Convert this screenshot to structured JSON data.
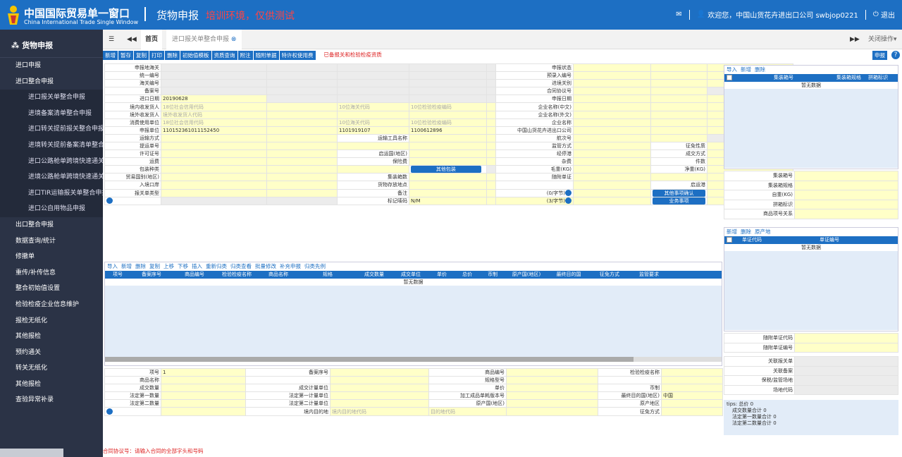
{
  "header": {
    "brand": "中国国际贸易单一窗口",
    "brand_en": "China International Trade Single Window",
    "title": "货物申报",
    "warning": "培训环境，仅供测试",
    "welcome": "欢迎您，中国山货花卉进出口公司 swbjop0221",
    "logout": "退出"
  },
  "sidebar": {
    "title": "货物申报",
    "items": [
      {
        "label": "进口申报",
        "sub": false
      },
      {
        "label": "进口整合申报",
        "sub": false
      },
      {
        "label": "进口报关单整合申报",
        "sub": true
      },
      {
        "label": "进境备案清单整合申报",
        "sub": true
      },
      {
        "label": "进口转关提前报关整合申报",
        "sub": true
      },
      {
        "label": "进境转关提前备案清单整合申报",
        "sub": true
      },
      {
        "label": "进口公路舱单跨境快速通关",
        "sub": true
      },
      {
        "label": "进境公路舱单跨境快速通关",
        "sub": true
      },
      {
        "label": "进口TIR运输报关单整合申报",
        "sub": true
      },
      {
        "label": "进口公自用物品申报",
        "sub": true
      },
      {
        "label": "出口整合申报",
        "sub": false
      },
      {
        "label": "数据查询/统计",
        "sub": false
      },
      {
        "label": "修撤单",
        "sub": false
      },
      {
        "label": "重传/补传信息",
        "sub": false
      },
      {
        "label": "整合初始值设置",
        "sub": false
      },
      {
        "label": "检验检疫企业信息维护",
        "sub": false
      },
      {
        "label": "报检无纸化",
        "sub": false
      },
      {
        "label": "其他报检",
        "sub": false
      },
      {
        "label": "预约通关",
        "sub": false
      },
      {
        "label": "转关无纸化",
        "sub": false
      },
      {
        "label": "其他报检",
        "sub": false
      },
      {
        "label": "查验异常补录",
        "sub": false
      }
    ]
  },
  "tabs": {
    "home": "首页",
    "active": "进口报关单整合申报",
    "close_ops": "关闭操作"
  },
  "toolbar": {
    "buttons": [
      "新增",
      "暂存",
      "复制",
      "打印",
      "删除",
      "初始值模板",
      "资质查询",
      "附注",
      "随附单据",
      "特许权使用费"
    ],
    "notice": "已备报关和检验检疫资质",
    "declare": "申报"
  },
  "form": {
    "rows": [
      [
        "申报地海关",
        "",
        "",
        "",
        "",
        "",
        "申报状态",
        "",
        "",
        ""
      ],
      [
        "统一编号",
        "",
        "",
        "",
        "",
        "",
        "预录入编号",
        "",
        "",
        ""
      ],
      [
        "海关编号",
        "",
        "",
        "",
        "",
        "",
        "进境关别",
        "",
        "",
        ""
      ],
      [
        "备案号",
        "",
        "",
        "",
        "",
        "",
        "合同协议号",
        "",
        "",
        ""
      ],
      [
        "进口日期",
        "20190628",
        "",
        "",
        "",
        "",
        "申报日期",
        "",
        "",
        ""
      ],
      [
        "境内收发货人",
        "18位社会信用代码",
        "",
        "10位海关代码",
        "10位检验检疫编码",
        "",
        "企业名称(中文)",
        "",
        "",
        ""
      ],
      [
        "境外收发货人",
        "境外收发货人代码",
        "",
        "",
        "",
        "",
        "企业名称(外文)",
        "",
        "",
        ""
      ],
      [
        "消费使用单位",
        "18位社会信用代码",
        "",
        "10位海关代码",
        "10位检验检疫编码",
        "",
        "企业名称",
        "",
        "",
        ""
      ],
      [
        "申报单位",
        "110152361011152450",
        "",
        "1101919107",
        "1100612896",
        "",
        "中国山货花卉进出口公司",
        "",
        "",
        ""
      ],
      [
        "运输方式",
        "",
        "",
        "运输工具名称",
        "",
        "",
        "航次号",
        "",
        "",
        ""
      ],
      [
        "提运单号",
        "",
        "",
        "",
        "",
        "",
        "监管方式",
        "",
        "征免性质",
        ""
      ],
      [
        "许可证号",
        "",
        "",
        "启运国(地区)",
        "",
        "",
        "经停港",
        "",
        "成交方式",
        ""
      ],
      [
        "运费",
        "",
        "",
        "保险费",
        "",
        "",
        "杂费",
        "",
        "件数",
        ""
      ],
      [
        "包装种类",
        "",
        "",
        "",
        "其他包装",
        "",
        "毛重(KG)",
        "",
        "净重(KG)",
        ""
      ],
      [
        "贸易国别(地区)",
        "",
        "",
        "集装箱数",
        "",
        "",
        "随附单证",
        "",
        "",
        ""
      ],
      [
        "入境口岸",
        "",
        "",
        "货物存放地点",
        "",
        "",
        "",
        "",
        "启运港",
        ""
      ],
      [
        "报关单类型",
        "",
        "",
        "备注",
        "",
        "",
        "",
        "",
        "",
        ""
      ],
      [
        "",
        "",
        "",
        "标记唛码",
        "N/M",
        "",
        "",
        "",
        "",
        ""
      ]
    ],
    "notes": "(0/字节)",
    "marks": "(3/字节)",
    "other_confirm": "其他事项确认",
    "business": "业务事项"
  },
  "goods": {
    "tools": [
      "导入",
      "新增",
      "删除",
      "复制",
      "上移",
      "下移",
      "插入",
      "重新归类",
      "归类查看",
      "批量修改",
      "补充申报",
      "归类先例"
    ],
    "columns": [
      "项号",
      "备案序号",
      "商品编号",
      "检验检疫名称",
      "商品名称",
      "规格",
      "成交数量",
      "成交单位",
      "单价",
      "总价",
      "币制",
      "原产国(地区)",
      "最终目的国",
      "征免方式",
      "监管要求"
    ],
    "empty": "暂无数据"
  },
  "container": {
    "tools": [
      "导入",
      "新增",
      "删除"
    ],
    "columns": [
      "集装箱号",
      "集装箱规格",
      "拼箱标识"
    ],
    "empty": "暂无数据",
    "fields": [
      "集装箱号",
      "集装箱规格",
      "自重(KG)",
      "拼箱标识",
      "商品项号关系"
    ]
  },
  "docs": {
    "tools": [
      "新增",
      "删除",
      "原产地"
    ],
    "columns": [
      "单证代码",
      "单证编号"
    ],
    "empty": "暂无数据",
    "fields": [
      "随附单证代码",
      "随附单证编号"
    ]
  },
  "related": {
    "fields": [
      "关联报关单",
      "关联备案",
      "保税/监管场地",
      "场地代码"
    ]
  },
  "tips": {
    "title": "tips: 总价 0",
    "lines": [
      "成交数量合计 0",
      "法定第一数量合计 0",
      "法定第二数量合计 0"
    ]
  },
  "detail": {
    "rows": [
      [
        "项号",
        "1",
        "备案序号",
        "",
        "商品编号",
        "",
        "检验检疫名称",
        ""
      ],
      [
        "商品名称",
        "",
        "",
        "",
        "规格型号",
        "",
        "",
        ""
      ],
      [
        "成交数量",
        "",
        "成交计量单位",
        "",
        "单价",
        "",
        "币制",
        ""
      ],
      [
        "法定第一数量",
        "",
        "法定第一计量单位",
        "",
        "加工成品单耗版本号",
        "",
        "货号",
        ""
      ],
      [
        "法定第二数量",
        "",
        "法定第二计量单位",
        "",
        "原产国(地区)",
        "",
        "原产地区",
        ""
      ],
      [
        "",
        "",
        "境内目的地",
        "境内目的地代码",
        "目的地代码",
        "",
        "征免方式",
        ""
      ]
    ],
    "final_country_label": "最终目的国(地区)",
    "final_country": "中国"
  },
  "status": "合同协议号：请输入合同的全部字头和号码"
}
